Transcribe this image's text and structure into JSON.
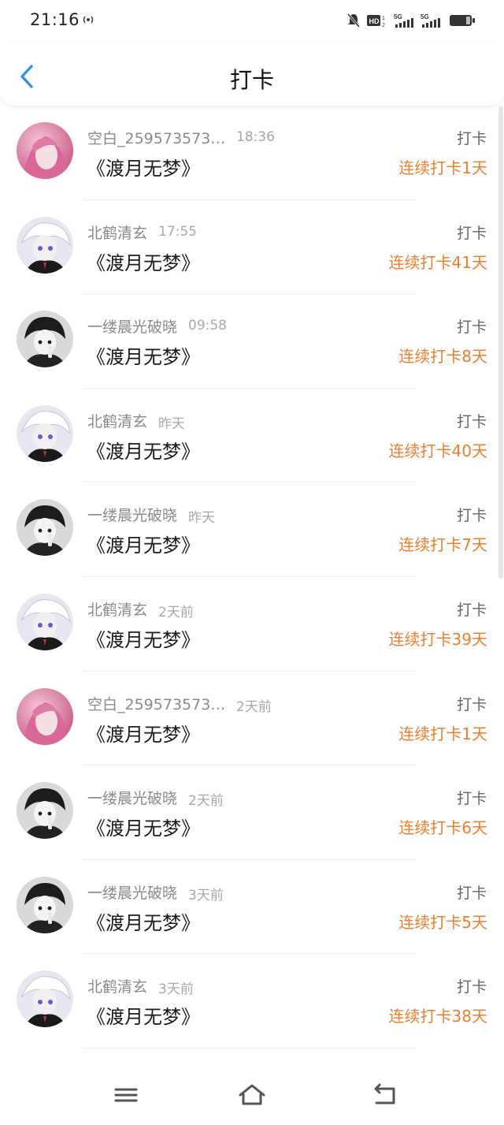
{
  "status_bar": {
    "time": "21:16"
  },
  "header": {
    "title": "打卡"
  },
  "colors": {
    "accent_blue": "#2c8ff0",
    "streak_orange": "#f07c2c"
  },
  "records": [
    {
      "user": "空白_259573573…",
      "time": "18:36",
      "book": "《渡月无梦》",
      "action": "打卡",
      "streak": "连续打卡1天",
      "avatar": "pink-hair-girl-avatar"
    },
    {
      "user": "北鹤清玄",
      "time": "17:55",
      "book": "《渡月无梦》",
      "action": "打卡",
      "streak": "连续打卡41天",
      "avatar": "white-hair-boy-avatar"
    },
    {
      "user": "一缕晨光破晓",
      "time": "09:58",
      "book": "《渡月无梦》",
      "action": "打卡",
      "streak": "连续打卡8天",
      "avatar": "dark-hair-boy-avatar"
    },
    {
      "user": "北鹤清玄",
      "time": "昨天",
      "book": "《渡月无梦》",
      "action": "打卡",
      "streak": "连续打卡40天",
      "avatar": "white-hair-boy-avatar"
    },
    {
      "user": "一缕晨光破晓",
      "time": "昨天",
      "book": "《渡月无梦》",
      "action": "打卡",
      "streak": "连续打卡7天",
      "avatar": "dark-hair-boy-avatar"
    },
    {
      "user": "北鹤清玄",
      "time": "2天前",
      "book": "《渡月无梦》",
      "action": "打卡",
      "streak": "连续打卡39天",
      "avatar": "white-hair-boy-avatar"
    },
    {
      "user": "空白_259573573…",
      "time": "2天前",
      "book": "《渡月无梦》",
      "action": "打卡",
      "streak": "连续打卡1天",
      "avatar": "pink-hair-girl-avatar"
    },
    {
      "user": "一缕晨光破晓",
      "time": "2天前",
      "book": "《渡月无梦》",
      "action": "打卡",
      "streak": "连续打卡6天",
      "avatar": "dark-hair-boy-avatar"
    },
    {
      "user": "一缕晨光破晓",
      "time": "3天前",
      "book": "《渡月无梦》",
      "action": "打卡",
      "streak": "连续打卡5天",
      "avatar": "dark-hair-boy-avatar"
    },
    {
      "user": "北鹤清玄",
      "time": "3天前",
      "book": "《渡月无梦》",
      "action": "打卡",
      "streak": "连续打卡38天",
      "avatar": "white-hair-boy-avatar"
    }
  ],
  "bottom_nav": {
    "icons": [
      "menu-icon",
      "home-icon",
      "back-icon"
    ]
  }
}
